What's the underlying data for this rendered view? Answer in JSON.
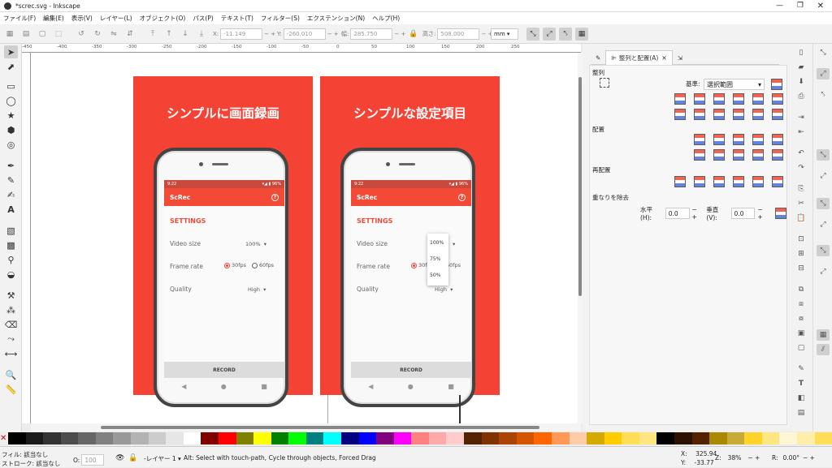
{
  "window": {
    "title": "*screc.svg - Inkscape"
  },
  "menus": [
    "ファイル(F)",
    "編集(E)",
    "表示(V)",
    "レイヤー(L)",
    "オブジェクト(O)",
    "パス(P)",
    "テキスト(T)",
    "フィルター(S)",
    "エクステンション(N)",
    "ヘルプ(H)"
  ],
  "toolbar": {
    "x_label": "X:",
    "x": "-11.149",
    "y_label": "Y:",
    "y": "-260.010",
    "w_label": "幅:",
    "w": "285.750",
    "h_label": "高さ:",
    "h": "508.000",
    "unit": "mm"
  },
  "ruler_ticks": [
    "-450",
    "-400",
    "-350",
    "-300",
    "-250",
    "-200",
    "-150",
    "-100",
    "-50",
    "0",
    "50",
    "100",
    "150",
    "200",
    "250"
  ],
  "artboards": [
    {
      "heading": "シンプルに画面録画",
      "status_time": "9:22",
      "status_right": "▾◢ ▮ 96%",
      "app_name": "ScRec",
      "help": "?",
      "settings": "SETTINGS",
      "video_size_label": "Video size",
      "video_size_value": "100%",
      "frame_rate_label": "Frame rate",
      "fps30": "30fps",
      "fps60": "60fps",
      "quality_label": "Quality",
      "quality_value": "High",
      "record": "RECORD"
    },
    {
      "heading": "シンプルな設定項目",
      "status_time": "9:22",
      "status_right": "▾◢ ▮ 96%",
      "app_name": "ScRec",
      "help": "?",
      "settings": "SETTINGS",
      "video_size_label": "Video size",
      "frame_rate_label": "Frame rate",
      "fps30": "30fps",
      "fps60": "60fps",
      "quality_label": "Quality",
      "quality_value": "High",
      "record": "RECORD",
      "dropdown": [
        "100%",
        "75%",
        "50%"
      ]
    }
  ],
  "dock": {
    "tabs": [
      "整列と配置(A)"
    ],
    "align_title": "整列",
    "relative_label": "基準:",
    "relative_value": "選択範囲",
    "distribute_title": "配置",
    "rearrange_title": "再配置",
    "overlap_title": "重なりを除去",
    "h_label": "水平(H):",
    "h_value": "0.0",
    "v_label": "垂直(V):",
    "v_value": "0.0"
  },
  "palette": [
    "#000000",
    "#1a1a1a",
    "#333333",
    "#4d4d4d",
    "#666666",
    "#808080",
    "#999999",
    "#b3b3b3",
    "#cccccc",
    "#e6e6e6",
    "#ffffff",
    "#800000",
    "#ff0000",
    "#808000",
    "#ffff00",
    "#008000",
    "#00ff00",
    "#008080",
    "#00ffff",
    "#000080",
    "#0000ff",
    "#800080",
    "#ff00ff",
    "#ff8080",
    "#ffaaaa",
    "#ffcccc",
    "#552200",
    "#803300",
    "#aa4400",
    "#d45500",
    "#ff6600",
    "#ff9955",
    "#ffccaa",
    "#d4aa00",
    "#ffcc00",
    "#ffdd55",
    "#ffe680",
    "#000000",
    "#2b1100",
    "#552200",
    "#aa8800",
    "#c8ab37",
    "#ffd42a",
    "#ffe680",
    "#fff6d5",
    "#ffeeaa",
    "#ffdd55"
  ],
  "status": {
    "fill_label": "フィル:",
    "fill_value": "該当なし",
    "stroke_label": "ストローク:",
    "stroke_value": "該当なし",
    "opacity_label": "O:",
    "opacity_value": "100",
    "layer": "-レイヤー 1",
    "hint": "Alt: Select with touch-path, Cycle through objects, Forced Drag",
    "x_label": "X:",
    "x": "325.94",
    "y_label": "Y:",
    "y": "-33.77",
    "zoom_label": "Z:",
    "zoom": "38%",
    "rot_label": "R:",
    "rotation": "0.00°"
  }
}
